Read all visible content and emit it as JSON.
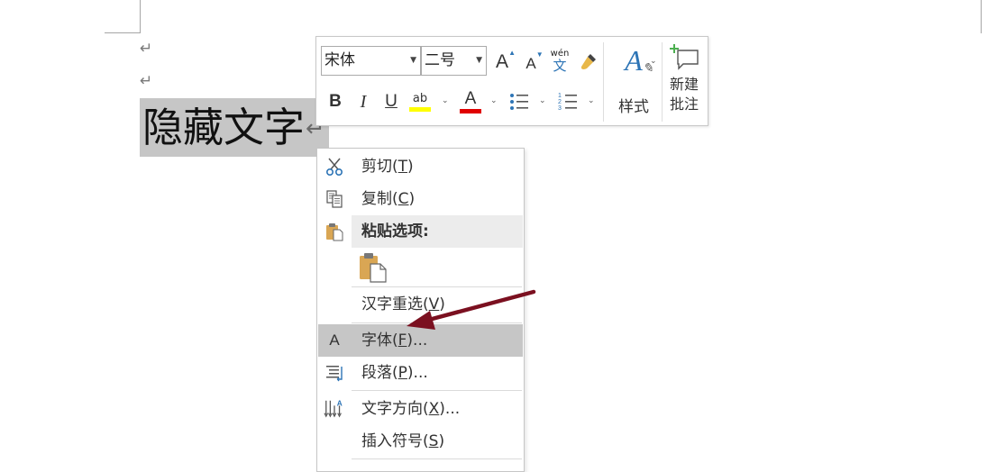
{
  "document": {
    "selected_text": "隐藏文字",
    "paragraph_mark": "↵"
  },
  "mini_toolbar": {
    "font_name": "宋体",
    "font_size": "二号",
    "grow_font": "A",
    "shrink_font": "A",
    "phonetic_top": "wén",
    "phonetic_bottom": "文",
    "bold": "B",
    "italic": "I",
    "underline": "U",
    "highlight_letters": "ab",
    "font_color_letter": "A",
    "styles_label": "样式",
    "new_comment_line1": "新建",
    "new_comment_line2": "批注",
    "colors": {
      "highlight": "#ffff00",
      "font_color": "#e00000",
      "accent_blue": "#2e75b6"
    }
  },
  "context_menu": {
    "items": [
      {
        "label": "剪切(",
        "key": "T",
        "suffix": ")",
        "icon": "scissors-icon"
      },
      {
        "label": "复制(",
        "key": "C",
        "suffix": ")",
        "icon": "copy-icon"
      },
      {
        "label": "粘贴选项:",
        "icon": "paste-icon"
      },
      {
        "icon": "paste-keep-text-icon"
      },
      {
        "label": "汉字重选(",
        "key": "V",
        "suffix": ")"
      },
      {
        "label": "字体(",
        "key": "F",
        "suffix": ")...",
        "icon": "font-icon",
        "icon_text": "A"
      },
      {
        "label": "段落(",
        "key": "P",
        "suffix": ")...",
        "icon": "paragraph-icon"
      },
      {
        "label": "文字方向(",
        "key": "X",
        "suffix": ")...",
        "icon": "text-direction-icon"
      },
      {
        "label": "插入符号(",
        "key": "S",
        "suffix": ")"
      }
    ]
  },
  "annotation": {
    "arrow_color": "#7b1020"
  }
}
